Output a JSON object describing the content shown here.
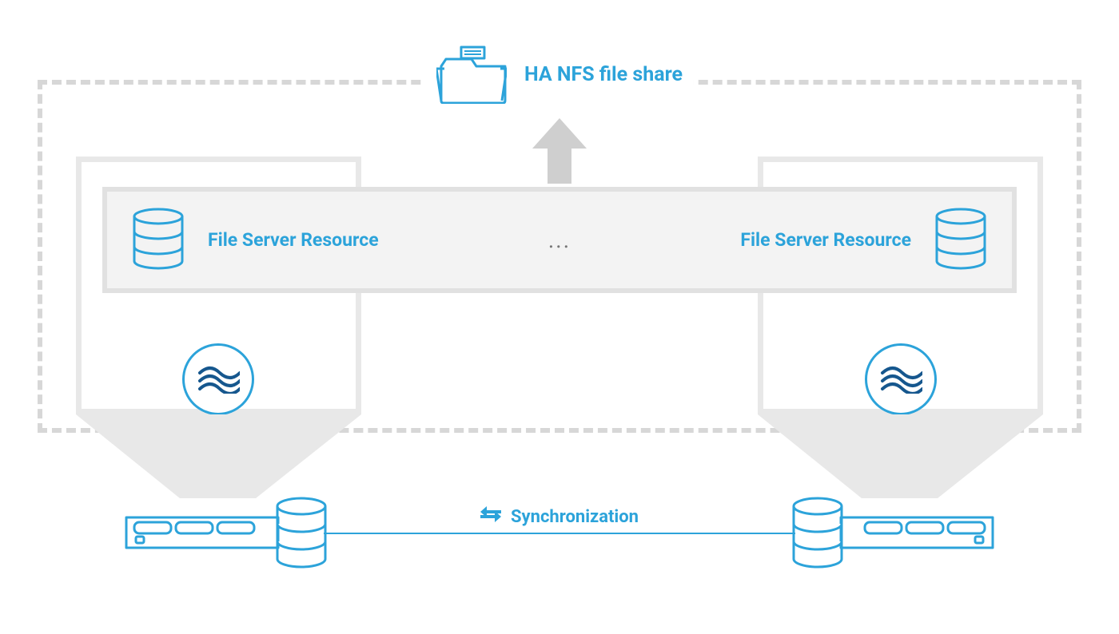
{
  "title": "HA NFS file share",
  "resource_left": "File Server Resource",
  "resource_right": "File Server Resource",
  "ellipsis": "...",
  "sync_label": "Synchronization",
  "colors": {
    "accent": "#2ca3da",
    "dark_accent": "#16578e",
    "grey": "#d7d7d7",
    "panel_border": "#e8e8e8",
    "panel_fill": "#f3f3f3",
    "arrow": "#cfcfcf",
    "text_muted": "#767676"
  }
}
